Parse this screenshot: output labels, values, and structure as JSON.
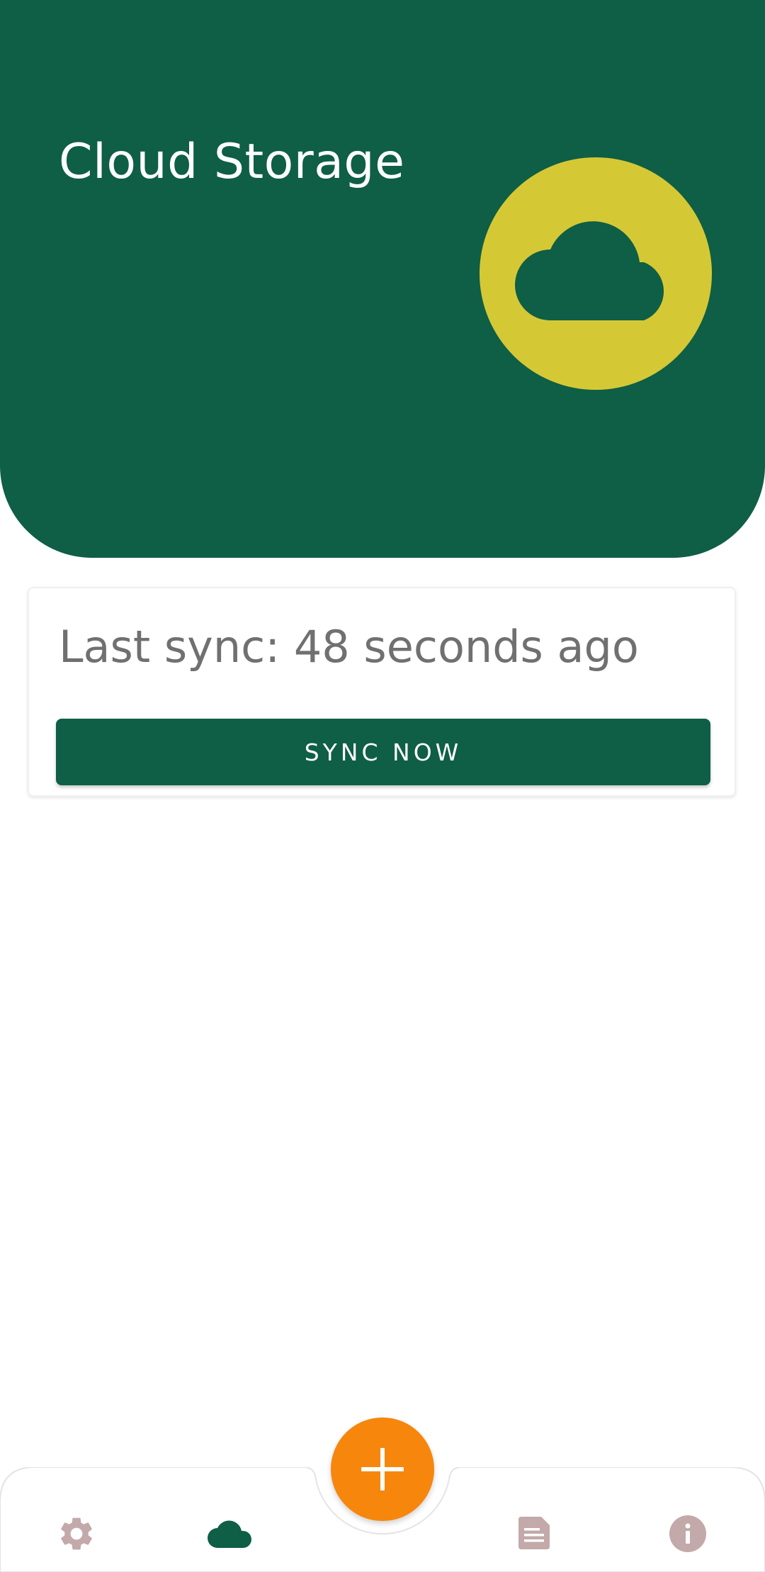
{
  "header": {
    "title": "Cloud Storage",
    "badge_icon": "cloud-icon",
    "background_color": "#0f5e46",
    "badge_color": "#d4c935"
  },
  "sync_card": {
    "status_text": "Last sync: 48 seconds ago",
    "button_label": "SYNC NOW",
    "button_color": "#0f5e46"
  },
  "bottom_nav": {
    "items": [
      {
        "icon": "gear-icon",
        "active": false
      },
      {
        "icon": "cloud-icon",
        "active": true
      },
      {
        "icon": "document-icon",
        "active": false
      },
      {
        "icon": "info-icon",
        "active": false
      }
    ],
    "fab_icon": "plus-icon",
    "fab_color": "#f7860c",
    "active_color": "#0f5e46",
    "inactive_color": "#c3a9a9"
  }
}
